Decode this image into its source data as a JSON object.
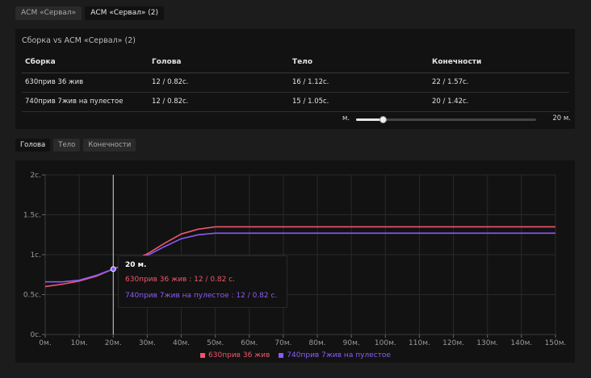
{
  "tabs": [
    {
      "label": "АСМ «Сервал»",
      "active": false
    },
    {
      "label": "АСМ «Сервал» (2)",
      "active": true
    }
  ],
  "compare": {
    "title": "Сборка vs АСМ «Сервал» (2)",
    "headers": [
      "Сборка",
      "Голова",
      "Тело",
      "Конечности"
    ],
    "rows": [
      [
        "630прив 36 жив",
        "12 / 0.82с.",
        "16 / 1.12с.",
        "22 / 1.57с."
      ],
      [
        "740прив 7жив на пулестое",
        "12 / 0.82с.",
        "15 / 1.05с.",
        "20 / 1.42с."
      ]
    ],
    "slider": {
      "min_label": "м.",
      "max_label": "20 м.",
      "value_fraction": 0.15
    }
  },
  "chart_tabs": [
    {
      "label": "Голова",
      "active": true
    },
    {
      "label": "Тело",
      "active": false
    },
    {
      "label": "Конечности",
      "active": false
    }
  ],
  "tooltip": {
    "title": "20 м.",
    "lines": [
      "630прив 36 жив : 12 / 0.82 с.",
      "740прив 7жив на пулестое : 12 / 0.82 с."
    ]
  },
  "colors": {
    "series1": "#f0566a",
    "series2": "#8b5cf6",
    "grid": "#2a2a2a",
    "axis": "#3c3c3c"
  },
  "chart_data": {
    "type": "line",
    "x_tick_labels": [
      "0м.",
      "10м.",
      "20м.",
      "30м.",
      "40м.",
      "50м.",
      "60м.",
      "70м.",
      "80м.",
      "90м.",
      "100м.",
      "110м.",
      "120м.",
      "130м.",
      "140м.",
      "150м."
    ],
    "y_tick_labels": [
      "0с.",
      "0.5с.",
      "1с.",
      "1.5с.",
      "2с."
    ],
    "xlim": [
      0,
      150
    ],
    "ylim": [
      0,
      2
    ],
    "grid": true,
    "legend": "bottom",
    "hover_x": 20,
    "series": [
      {
        "name": "630прив 36 жив",
        "x": [
          0,
          5,
          10,
          15,
          20,
          25,
          30,
          35,
          40,
          45,
          50,
          55,
          60,
          150
        ],
        "y": [
          0.6,
          0.63,
          0.67,
          0.73,
          0.82,
          0.91,
          1.01,
          1.14,
          1.26,
          1.32,
          1.35,
          1.35,
          1.35,
          1.35
        ]
      },
      {
        "name": "740прив 7жив на пулестое",
        "x": [
          0,
          5,
          10,
          15,
          20,
          25,
          30,
          35,
          40,
          45,
          50,
          55,
          60,
          150
        ],
        "y": [
          0.66,
          0.66,
          0.68,
          0.74,
          0.82,
          0.9,
          0.99,
          1.1,
          1.2,
          1.25,
          1.27,
          1.27,
          1.27,
          1.27
        ]
      }
    ]
  }
}
